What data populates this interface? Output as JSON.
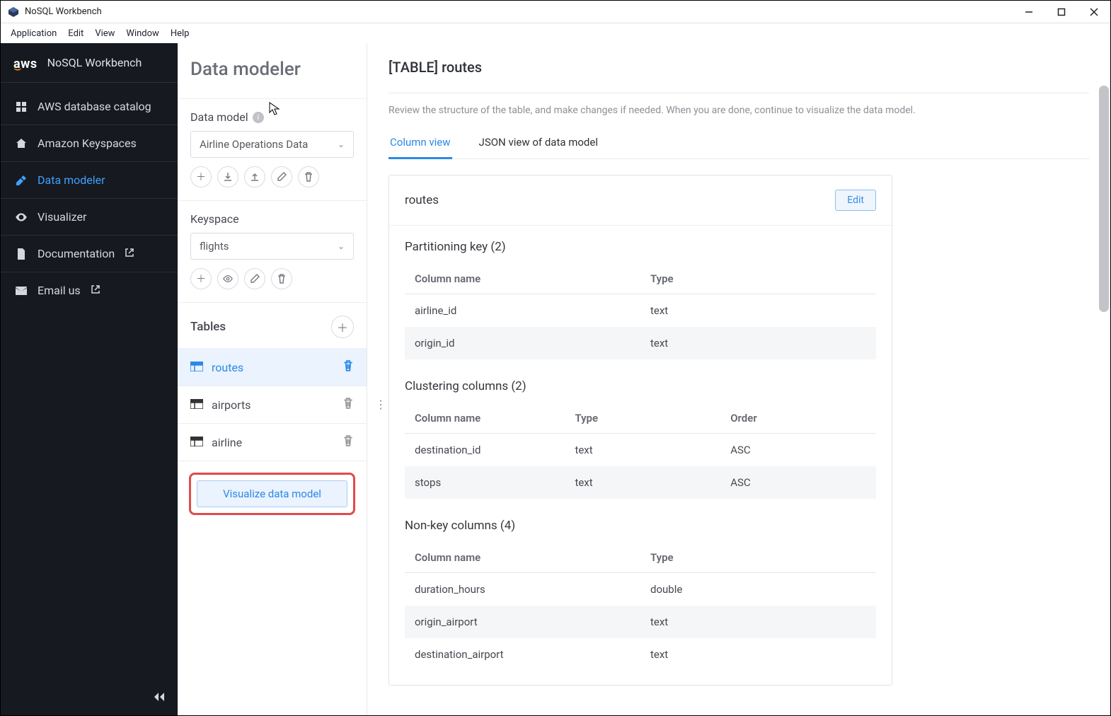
{
  "window": {
    "title": "NoSQL Workbench"
  },
  "menubar": [
    "Application",
    "Edit",
    "View",
    "Window",
    "Help"
  ],
  "sidebar": {
    "brand": "aws",
    "title": "NoSQL Workbench",
    "items": [
      {
        "label": "AWS database catalog",
        "icon": "grid"
      },
      {
        "label": "Amazon Keyspaces",
        "icon": "home"
      },
      {
        "label": "Data modeler",
        "icon": "tool",
        "active": true
      },
      {
        "label": "Visualizer",
        "icon": "eye"
      },
      {
        "label": "Documentation",
        "icon": "doc",
        "ext": true
      },
      {
        "label": "Email us",
        "icon": "mail",
        "ext": true
      }
    ]
  },
  "middle": {
    "heading": "Data modeler",
    "model_label": "Data model",
    "model_value": "Airline Operations Data",
    "keyspace_label": "Keyspace",
    "keyspace_value": "flights",
    "tables_label": "Tables",
    "tables": [
      {
        "name": "routes",
        "active": true
      },
      {
        "name": "airports"
      },
      {
        "name": "airline"
      }
    ],
    "visualize_label": "Visualize data model"
  },
  "content": {
    "title": "[TABLE] routes",
    "description": "Review the structure of the table, and make changes if needed. When you are done, continue to visualize the data model.",
    "tabs": [
      {
        "label": "Column view",
        "active": true
      },
      {
        "label": "JSON view of data model"
      }
    ],
    "card_title": "routes",
    "edit_label": "Edit",
    "partitioning": {
      "title": "Partitioning key (2)",
      "headers": [
        "Column name",
        "Type"
      ],
      "rows": [
        {
          "name": "airline_id",
          "type": "text"
        },
        {
          "name": "origin_id",
          "type": "text"
        }
      ]
    },
    "clustering": {
      "title": "Clustering columns (2)",
      "headers": [
        "Column name",
        "Type",
        "Order"
      ],
      "rows": [
        {
          "name": "destination_id",
          "type": "text",
          "order": "ASC"
        },
        {
          "name": "stops",
          "type": "text",
          "order": "ASC"
        }
      ]
    },
    "nonkey": {
      "title": "Non-key columns (4)",
      "headers": [
        "Column name",
        "Type"
      ],
      "rows": [
        {
          "name": "duration_hours",
          "type": "double"
        },
        {
          "name": "origin_airport",
          "type": "text"
        },
        {
          "name": "destination_airport",
          "type": "text"
        }
      ]
    }
  }
}
